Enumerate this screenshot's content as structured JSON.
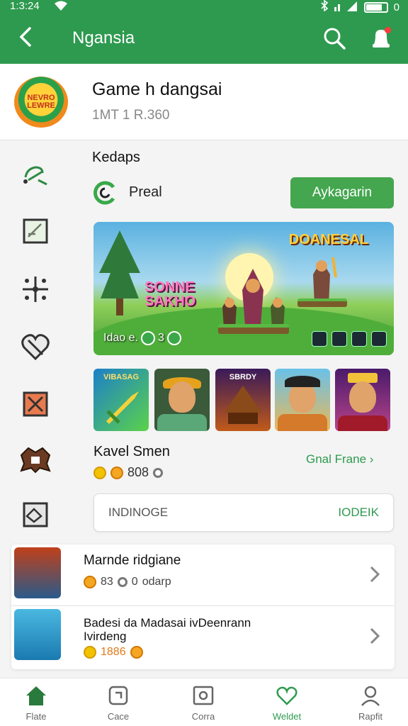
{
  "status": {
    "time": "1:3:24",
    "battery_label": "0",
    "battery_level": 0.8
  },
  "appbar": {
    "title": "Ngansia"
  },
  "game": {
    "title": "Game h dangsai",
    "subtitle": "1MT 1 R.360",
    "logo_text": "NEVRO LEWRE"
  },
  "section": {
    "title": "Kedaps",
    "row_label": "Preal",
    "row_button": "Aykagarin"
  },
  "banner": {
    "title": "DOANESAL",
    "left_title": "SONNE SAKHO",
    "bottom_text": "Idao e.",
    "count": "3"
  },
  "thumbs": [
    "VIBASAG",
    "",
    "SBRDY",
    "",
    ""
  ],
  "kavel": {
    "title": "Kavel Smen",
    "meta": "808",
    "link": "Gnal Frane"
  },
  "input_card": {
    "field": "INDINOGE",
    "action": "IODEIK"
  },
  "list": [
    {
      "title": "Marnde ridgiane",
      "meta1": "83",
      "meta2": "0",
      "meta3": "odarp"
    },
    {
      "title": "Badesi da Madasai ivDeenrann Ivirdeng",
      "meta1": "1886"
    }
  ],
  "nav": [
    {
      "label": "Flate",
      "icon": "home-icon",
      "active": false
    },
    {
      "label": "Cace",
      "icon": "game-card-icon",
      "active": false
    },
    {
      "label": "Corra",
      "icon": "photo-icon",
      "active": false
    },
    {
      "label": "Weldet",
      "icon": "heart-icon",
      "active": true
    },
    {
      "label": "Rapfit",
      "icon": "profile-icon",
      "active": false
    }
  ],
  "colors": {
    "primary": "#2e9a4f",
    "button": "#44a64f",
    "background": "#f3f4f3"
  }
}
